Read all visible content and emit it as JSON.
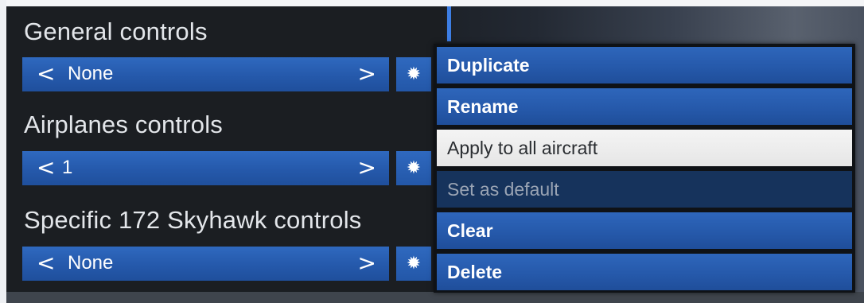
{
  "sections": [
    {
      "title": "General controls",
      "value": "None"
    },
    {
      "title": "Airplanes controls",
      "value": "1"
    },
    {
      "title": "Specific 172 Skyhawk controls",
      "value": "None"
    }
  ],
  "selector_icons": {
    "prev": "chevron-left-icon",
    "next": "chevron-right-icon",
    "prev_glyph": "<",
    "next_glyph": ">",
    "settings": "gear-icon",
    "settings_glyph": "✹"
  },
  "context_menu": {
    "items": [
      {
        "label": "Duplicate",
        "state": "normal"
      },
      {
        "label": "Rename",
        "state": "normal"
      },
      {
        "label": "Apply to all aircraft",
        "state": "hover"
      },
      {
        "label": "Set as default",
        "state": "disabled"
      },
      {
        "label": "Clear",
        "state": "normal"
      },
      {
        "label": "Delete",
        "state": "normal"
      }
    ]
  },
  "colors": {
    "accent_blue": "#2a5fb3",
    "panel_bg": "#1b1e22",
    "hover_bg": "#ececec",
    "disabled_bg": "#16335c"
  }
}
